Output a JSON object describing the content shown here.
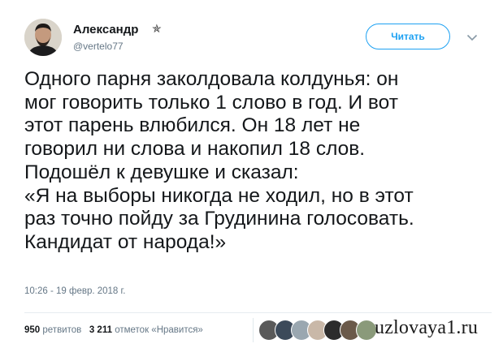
{
  "author": {
    "name": "Александр",
    "badge_icon": "star-icon",
    "handle": "@vertelo77"
  },
  "follow_button": {
    "label": "Читать"
  },
  "menu": {
    "icon": "chevron-down-icon"
  },
  "tweet": {
    "text": "Одного парня заколдовала колдунья: он\nмог говорить только 1 слово в год. И вот\nэтот парень влюбился. Он 18 лет не\nговорил ни слова и накопил 18 слов.\nПодошёл к девушке и сказал:\n«Я на выборы никогда не ходил, но в этот\nраз точно пойду за Грудинина голосовать.\nКандидат от народа!»",
    "timestamp": "10:26 - 19 февр. 2018 г."
  },
  "stats": {
    "retweets_count": "950",
    "retweets_label": "ретвитов",
    "likes_count": "3 211",
    "likes_label": "отметок «Нравится»"
  },
  "liker_avatars": [
    "#5a5a5a",
    "#3c4a5a",
    "#9aa7b0",
    "#c9b8a8",
    "#2c2c2c",
    "#6b5a4a",
    "#8a9a7a"
  ],
  "watermark": "uzlovaya1.ru",
  "colors": {
    "accent": "#1da1f2",
    "secondary_text": "#657786"
  }
}
